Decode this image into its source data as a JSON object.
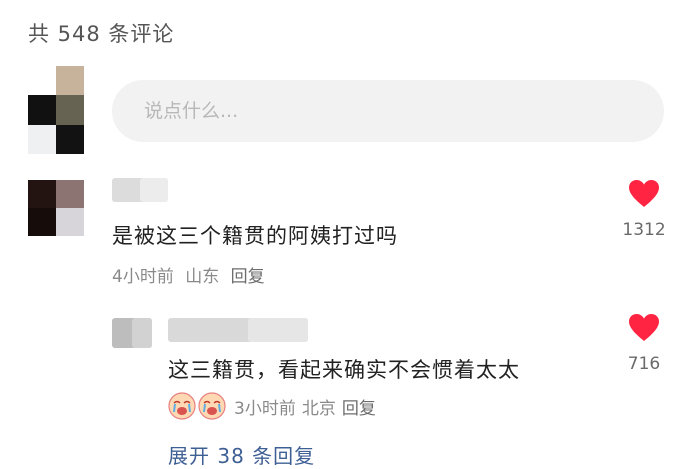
{
  "header": {
    "comment_count": "共 548 条评论"
  },
  "composer": {
    "placeholder": "说点什么..."
  },
  "comments": [
    {
      "text": "是被这三个籍贯的阿姨打过吗",
      "time": "4小时前",
      "location": "山东",
      "reply_label": "回复",
      "likes": "1312",
      "like_icon": "heart-icon",
      "like_color": "#ff2442"
    }
  ],
  "replies": [
    {
      "text": "这三籍贯，看起来确实不会惯着太太",
      "emojis": [
        "crying-face-emoji",
        "crying-face-emoji"
      ],
      "time": "3小时前",
      "location": "北京",
      "reply_label": "回复",
      "likes": "716",
      "like_icon": "heart-icon",
      "like_color": "#ff2442"
    }
  ],
  "expand_replies": "展开 38 条回复"
}
